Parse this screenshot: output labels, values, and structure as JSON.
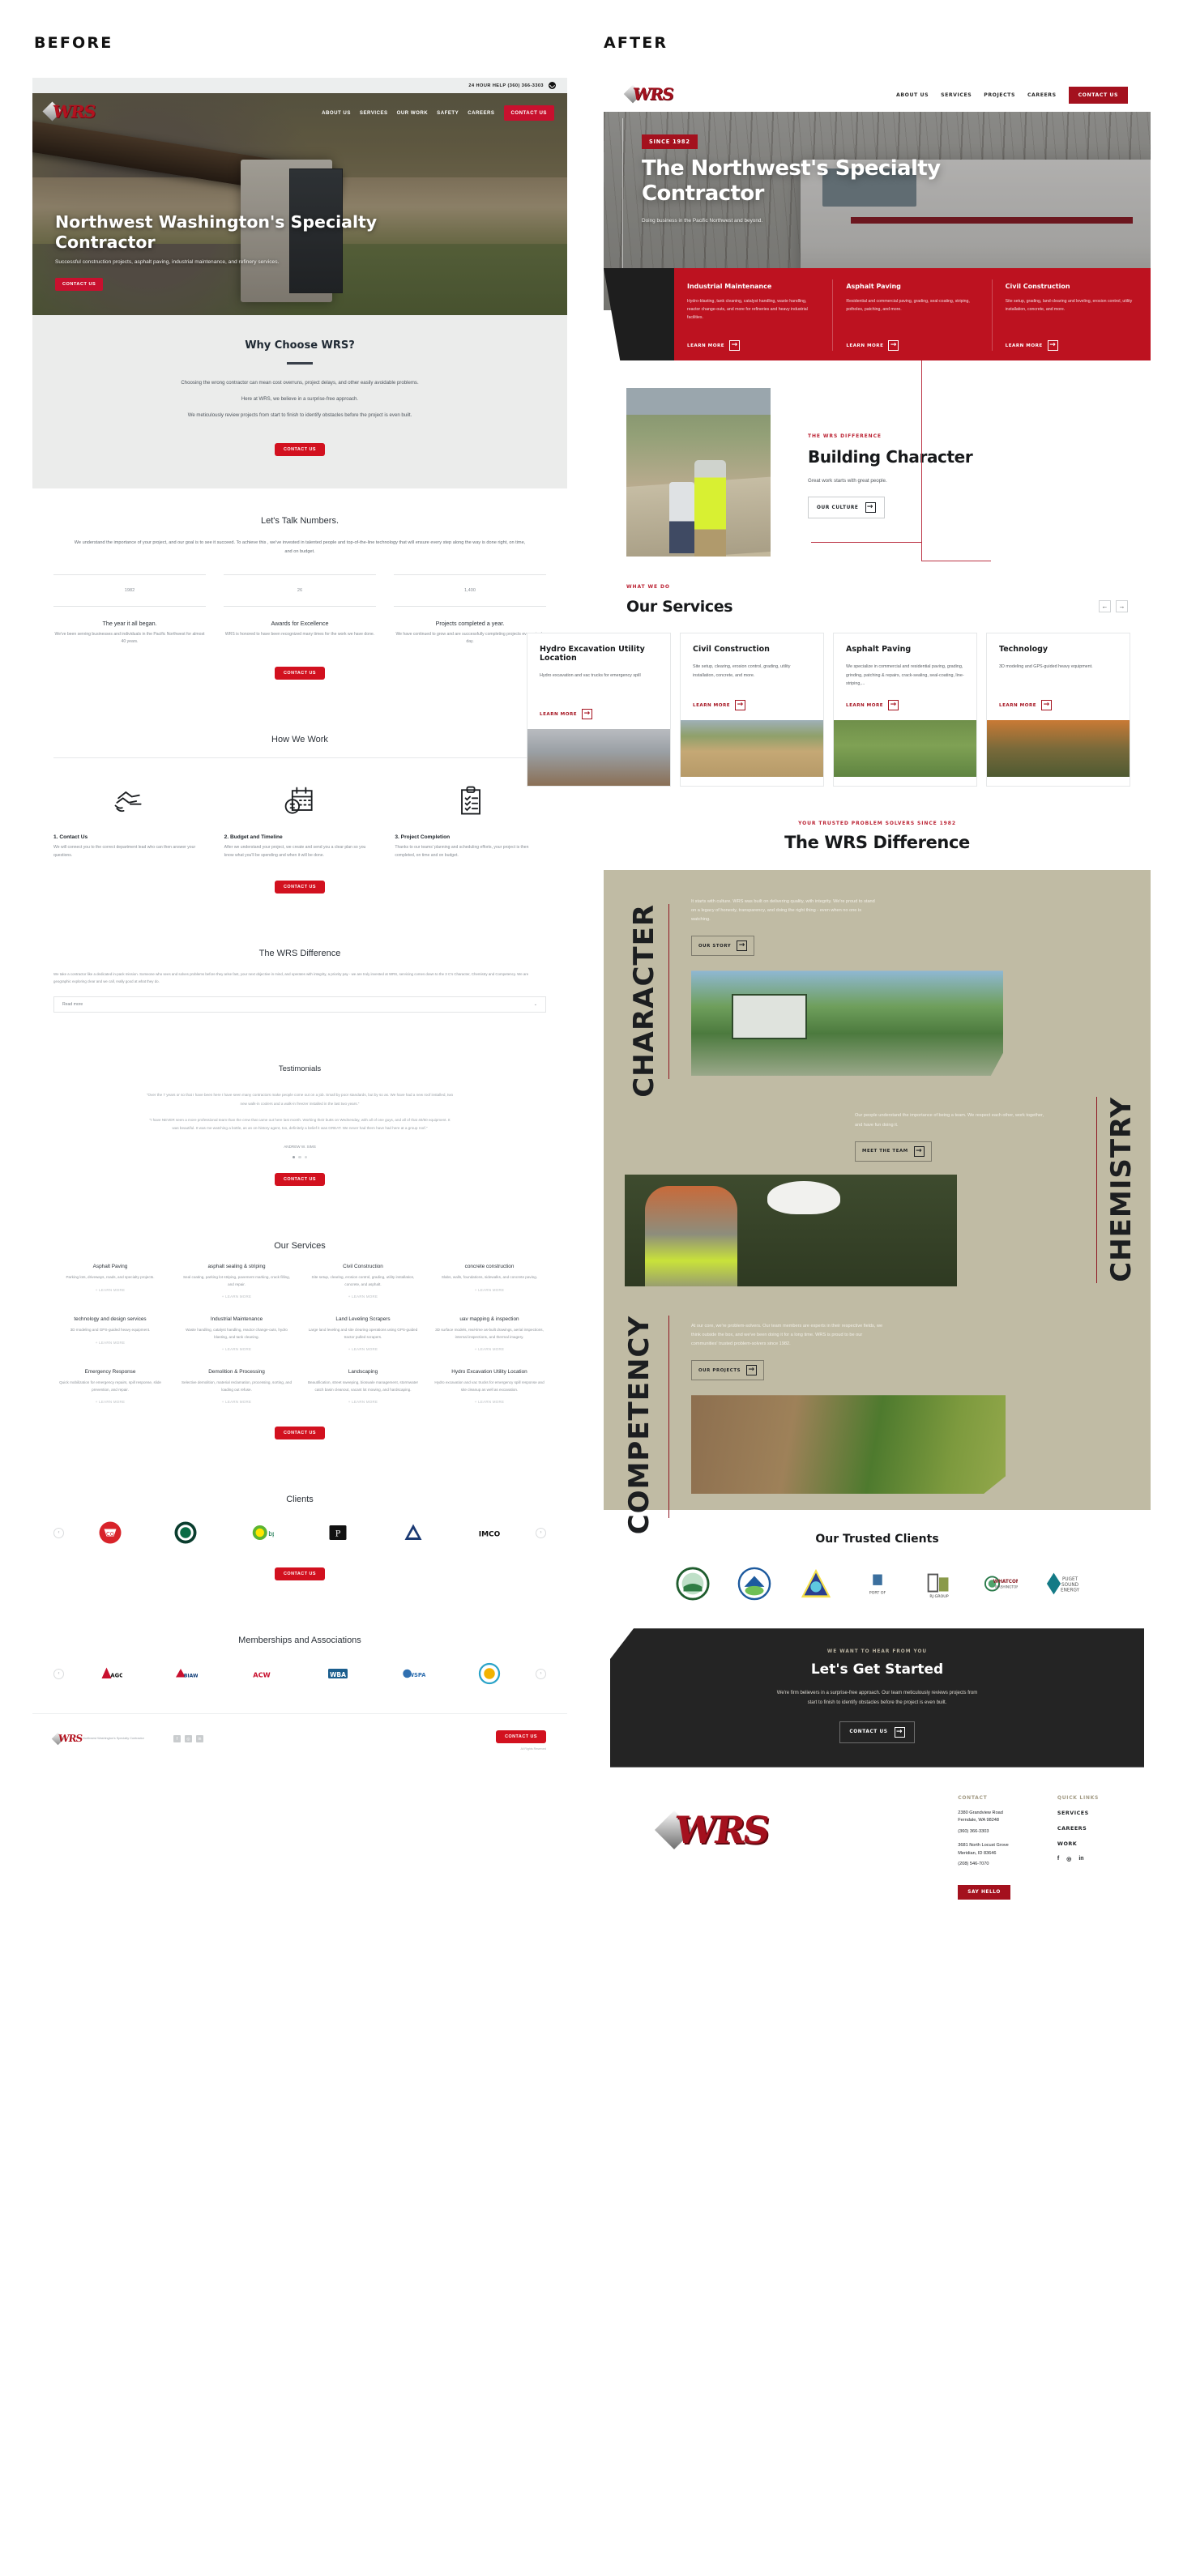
{
  "labels": {
    "before": "BEFORE",
    "after": "AFTER"
  },
  "before": {
    "topbar": {
      "phone_text": "24 HOUR HELP (360) 366-3303",
      "phone_icon": "phone-icon"
    },
    "nav": {
      "logo_text": "WRS",
      "items": [
        "ABOUT US",
        "SERVICES",
        "OUR WORK",
        "SAFETY",
        "CAREERS"
      ],
      "cta": "CONTACT US"
    },
    "hero": {
      "title": "Northwest Washington's Specialty Contractor",
      "subtitle": "Successful construction projects, asphalt paving, industrial maintenance, and refinery services.",
      "cta": "CONTACT US"
    },
    "why": {
      "heading": "Why Choose WRS?",
      "paragraphs": [
        "Choosing the wrong contractor can mean cost overruns, project delays, and other easily avoidable problems.",
        "Here at WRS, we believe in a surprise-free approach.",
        "We meticulously review projects from start to finish to identify obstacles before the project is even built."
      ],
      "cta": "CONTACT US"
    },
    "numbers": {
      "heading": "Let's Talk Numbers.",
      "lead": "We understand the importance of your project, and our goal is to see it succeed. To achieve this , we've invested in talented people and top-of-the-line technology that will ensure every step along the way is done right, on time, and on budget.",
      "stats": [
        {
          "value": "1982",
          "title": "The year it all began.",
          "desc": "We've been serving businesses and individuals in the Pacific Northwest for almost 40 years."
        },
        {
          "value": "26",
          "title": "Awards for Excellence",
          "desc": "WRS is honored to have been recognized many times for the work we have done."
        },
        {
          "value": "1,400",
          "title": "Projects completed a year.",
          "desc": "We have continued to grow and are successfully completing projects every single day."
        }
      ],
      "cta": "CONTACT US"
    },
    "how": {
      "heading": "How We Work",
      "steps": [
        {
          "icon": "handshake-icon",
          "title": "1. Contact Us",
          "desc": "We will connect you to the correct department lead who can then answer your questions."
        },
        {
          "icon": "calendar-dollar-icon",
          "title": "2. Budget and Timeline",
          "desc": "After we understand your project, we create and send you a clear plan so you know what you'll be spending and when it will be done."
        },
        {
          "icon": "clipboard-check-icon",
          "title": "3. Project Completion",
          "desc": "Thanks to our teams' planning and scheduling efforts, your project is then completed, on time and on budget."
        }
      ],
      "cta": "CONTACT US"
    },
    "difference": {
      "heading": "The WRS Difference",
      "body": "We take a contractor like a dedicated in-pack mission. Someone who sees and solves problems before they arise fast, your next objective in mind, and operates with integrity, a priority pay - we are truly invested at WRS, servicing comes down to the 3 C's Character, Chemistry and Competency. We are geographic exploring clear and we call, really good at what they do.",
      "readmore": "Read more"
    },
    "testimonials": {
      "heading": "Testimonials",
      "quotes": [
        "\"Over the 7 years or so that I have been here I have seen many contractors make people come out on a job. Small by poor standards, but by so as. We have had a new roof installed, two new walk-in coolers and a walk-in freezer installed in the last two years.\"",
        "\"I have NEVER seen a more professional team than the crew that came out here last month. Working their butts on Wednesday, with all of one guys, and all of that 40/50 equipment. It was beautiful. It was me watching a bottle, as an on-history agent, too, definitely a belief it was GREAT. We never had them have had here at a group roof.\""
      ],
      "author": "ANDREW W. SIMS",
      "cta": "CONTACT US"
    },
    "services": {
      "heading": "Our Services",
      "items": [
        {
          "title": "Asphalt Paving",
          "desc": "Parking lots, driveways, roads, and specialty projects.",
          "more": "+ LEARN MORE"
        },
        {
          "title": "asphalt sealing & striping",
          "desc": "Seal coating, parking lot striping, pavement marking, crack filling, and repair.",
          "more": "+ LEARN MORE"
        },
        {
          "title": "Civil Construction",
          "desc": "Site setup, clearing, erosion control, grading, utility installation, concrete, and asphalt.",
          "more": "+ LEARN MORE"
        },
        {
          "title": "concrete construction",
          "desc": "Slabs, walls, foundations, sidewalks, and concrete paving.",
          "more": "+ LEARN MORE"
        },
        {
          "title": "technology and design services",
          "desc": "3D modeling and GPS-guided heavy equipment.",
          "more": "+ LEARN MORE"
        },
        {
          "title": "Industrial Maintenance",
          "desc": "Waste handling, catalyst handling, reactor change-outs, hydro blasting, and tank cleaning.",
          "more": "+ LEARN MORE"
        },
        {
          "title": "Land Leveling Scrapers",
          "desc": "Large land leveling and site clearing operations using GPS-guided tractor pulled scrapers.",
          "more": "+ LEARN MORE"
        },
        {
          "title": "uav mapping & inspection",
          "desc": "3D surface models, real-time as-built drawings, aerial inspections, internal inspections, and thermal imagery.",
          "more": "+ LEARN MORE"
        },
        {
          "title": "Emergency Response",
          "desc": "Quick mobilization for emergency repairs, spill response, slide prevention, and repair.",
          "more": "+ LEARN MORE"
        },
        {
          "title": "Demolition & Processing",
          "desc": "Selective demolition, material reclamation, processing, sorting, and loading out refuse.",
          "more": "+ LEARN MORE"
        },
        {
          "title": "Landscaping",
          "desc": "Beautification, street sweeping, bioswale management, stormwater catch basin cleanout, vacant lot mowing, and hardscaping.",
          "more": "+ LEARN MORE"
        },
        {
          "title": "Hydro Excavation Utility Location",
          "desc": "Hydro excavation and vac trucks for emergency spill response and site cleanup as well as excavation.",
          "more": "+ LEARN MORE"
        }
      ],
      "cta": "CONTACT US"
    },
    "clients": {
      "heading": "Clients",
      "logos": [
        "chevron-shield-logo",
        "andeavor-logo",
        "bp-logo",
        "phillips-66-logo",
        "ncc-triangle-logo",
        "imco-logo"
      ],
      "cta": "CONTACT US"
    },
    "memberships": {
      "heading": "Memberships and Associations",
      "logos": [
        "agc-logo",
        "biaw-logo",
        "acw-logo",
        "wba-logo",
        "wspa-logo",
        "seal-logo"
      ]
    },
    "footer": {
      "company": "Northwest Washington's Specialty Contractor",
      "social": [
        "facebook-icon",
        "instagram-icon",
        "linkedin-icon"
      ],
      "cta": "CONTACT US",
      "rights": "All Rights Reserved"
    }
  },
  "after": {
    "nav": {
      "logo_text": "WRS",
      "items": [
        "ABOUT US",
        "SERVICES",
        "PROJECTS",
        "CAREERS"
      ],
      "cta": "CONTACT US"
    },
    "hero": {
      "badge": "SINCE 1982",
      "title": "The Northwest's Specialty Contractor",
      "subtitle": "Doing business in the Pacific Northwest and beyond."
    },
    "hero_cards": [
      {
        "title": "Industrial Maintenance",
        "desc": "Hydro-blasting, tank cleaning, catalyst handling, waste handling, reactor change-outs, and more for refineries and heavy industrial facilities.",
        "more": "LEARN MORE"
      },
      {
        "title": "Asphalt Paving",
        "desc": "Residential and commercial paving, grading, seal-coating, striping, potholes, patching, and more.",
        "more": "LEARN MORE"
      },
      {
        "title": "Civil Construction",
        "desc": "Site setup, grading, land-clearing and leveling, erosion control, utility installation, concrete, and more.",
        "more": "LEARN MORE"
      }
    ],
    "character": {
      "eyebrow": "THE WRS DIFFERENCE",
      "title": "Building Character",
      "subtitle": "Great work starts with great people.",
      "cta": "OUR CULTURE"
    },
    "services": {
      "eyebrow": "WHAT WE DO",
      "title": "Our Services",
      "prev_icon": "arrow-left-icon",
      "next_icon": "arrow-right-icon",
      "cards": [
        {
          "title": "Hydro Excavation Utility Location",
          "desc": "Hydro excavation and vac trucks for emergency spill",
          "more": "LEARN MORE",
          "photo": "ph-hydro"
        },
        {
          "title": "Civil Construction",
          "desc": "Site setup, clearing, erosion control, grading, utility installation, concrete, and more.",
          "more": "LEARN MORE",
          "photo": "ph-civil"
        },
        {
          "title": "Asphalt Paving",
          "desc": "We specialize in commercial and residential paving, grading, grinding, patching & repairs, crack-sealing, seal-coating, line-striping,...",
          "more": "LEARN MORE",
          "photo": "ph-asphalt"
        },
        {
          "title": "Technology",
          "desc": "3D modeling and GPS-guided heavy equipment.",
          "more": "LEARN MORE",
          "photo": "ph-tech"
        }
      ]
    },
    "difference": {
      "eyebrow": "YOUR TRUSTED PROBLEM SOLVERS SINCE 1982",
      "title": "The WRS Difference",
      "blocks": [
        {
          "word": "CHARACTER",
          "text": "It starts with culture. WRS was built on delivering quality, with integrity. We're proud to stand on a legacy of honesty, transparency, and doing the right thing - even when no one is watching.",
          "cta": "OUR STORY"
        },
        {
          "word": "CHEMISTRY",
          "text": "Our people understand the importance of being a team. We respect each other, work together, and have fun doing it.",
          "cta": "MEET THE TEAM"
        },
        {
          "word": "COMPETENCY",
          "text": "At our core, we're problem-solvers. Our team members are experts in their respective fields, we think outside the box, and we've been doing it for a long time. WRS is proud to be our communities' trusted problem-solvers since 1982.",
          "cta": "OUR PROJECTS"
        }
      ]
    },
    "clients": {
      "heading": "Our Trusted Clients",
      "logos": [
        "city-of-lynden-public-works-logo",
        "city-of-bellingham-washington-logo",
        "nas-whidbey-island-logo",
        "port-of-bellingham-logo",
        "rj-group-logo",
        "whatcom-county-washington-logo",
        "puget-sound-energy-logo"
      ]
    },
    "cta": {
      "eyebrow": "WE WANT TO HEAR FROM YOU",
      "title": "Let's Get Started",
      "body": "We're firm believers in a surprise-free approach. Our team meticulously reviews projects from start to finish to identify obstacles before the project is even built.",
      "button": "CONTACT US"
    },
    "footer": {
      "logo_text": "WRS",
      "contact_heading": "CONTACT",
      "addresses": [
        {
          "street": "2380 Grandview Road",
          "city": "Ferndale, WA 98248",
          "phone": "(360) 366-3303"
        },
        {
          "street": "3681 North Locust Grove",
          "city": "Meridian, ID 83646",
          "phone": "(208) 546-7070"
        }
      ],
      "say_hello": "SAY HELLO",
      "quick_heading": "QUICK LINKS",
      "quick_links": [
        "SERVICES",
        "CAREERS",
        "WORK"
      ],
      "social": [
        "facebook-icon",
        "instagram-icon",
        "linkedin-icon"
      ]
    }
  },
  "colors": {
    "brand_red": "#a4111e",
    "strip_red": "#bd1220",
    "tan": "#c0bba4",
    "dark": "#242424"
  }
}
